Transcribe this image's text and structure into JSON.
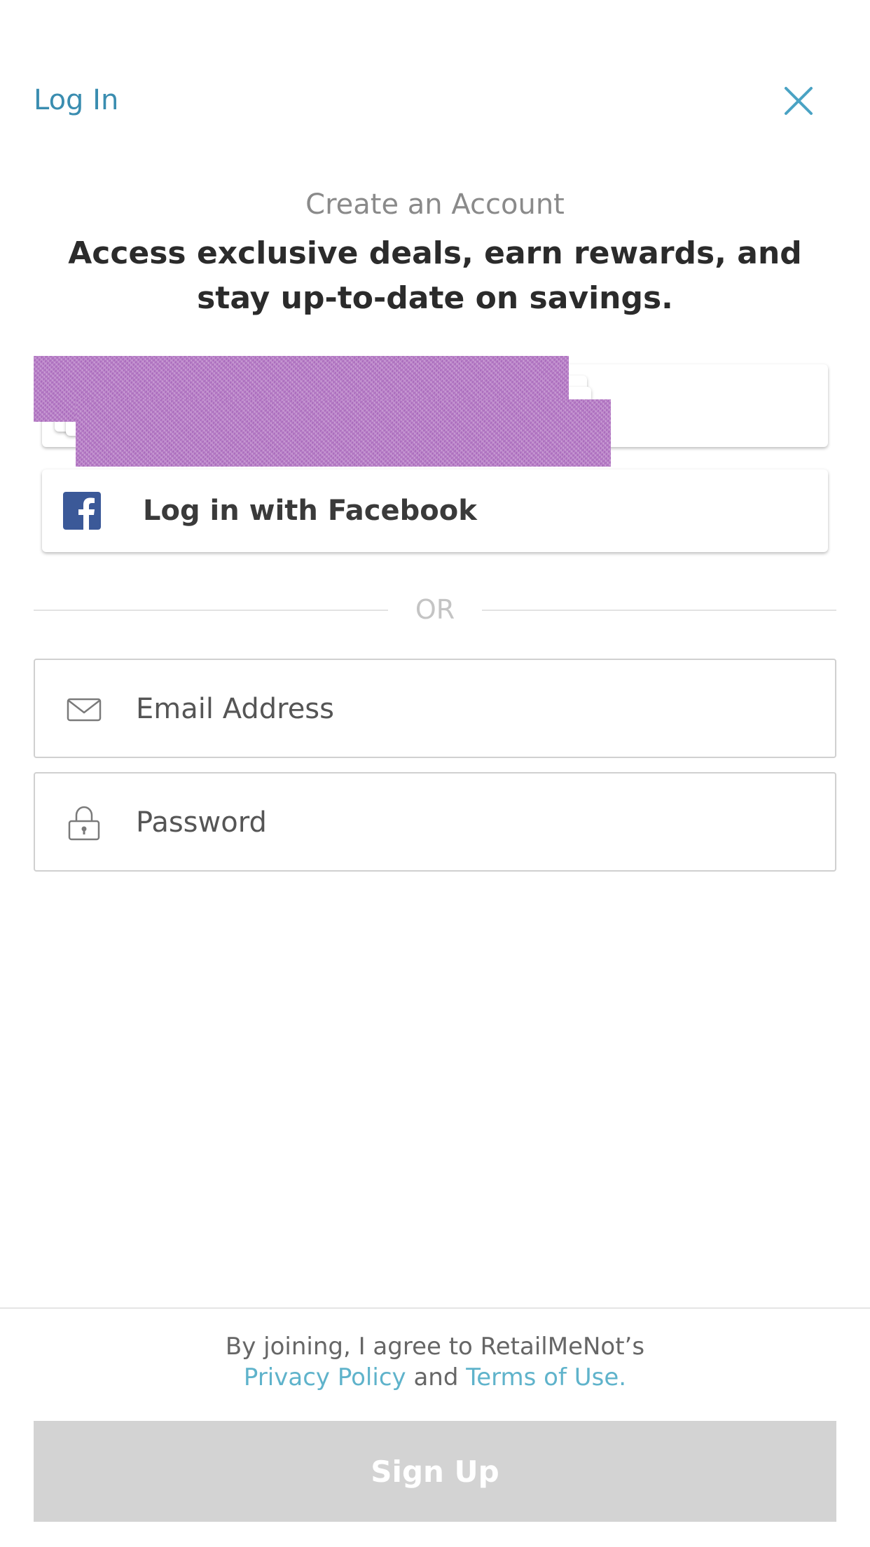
{
  "header": {
    "login_label": "Log In",
    "close_icon": "close-icon",
    "accent_color": "#3a8db0"
  },
  "intro": {
    "title": "Create an Account",
    "tagline": "Access exclusive deals, earn rewards, and stay up-to-date on savings."
  },
  "social": {
    "facebook_label": "Log in with Facebook",
    "facebook_icon": "facebook-icon",
    "facebook_color": "#3b5998"
  },
  "divider": {
    "label": "OR"
  },
  "form": {
    "email_placeholder": "Email Address",
    "email_icon": "envelope-icon",
    "password_placeholder": "Password",
    "password_icon": "lock-icon"
  },
  "footer": {
    "legal_prefix": "By joining, I agree to RetailMeNot’s",
    "privacy_label": "Privacy Policy",
    "and_label": "and",
    "terms_label": "Terms of Use.",
    "link_color": "#5fb3cb",
    "signup_label": "Sign Up",
    "signup_bg": "#d3d3d3"
  }
}
